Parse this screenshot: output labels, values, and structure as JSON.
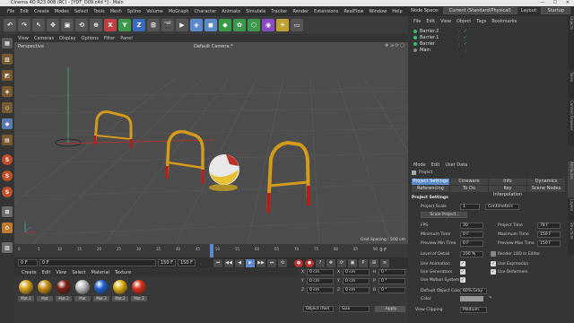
{
  "window": {
    "title": "Cinema 4D R23.008 (RC) - [YDT_D09.c4d *] - Main",
    "controls": [
      "—",
      "☐",
      "✕"
    ]
  },
  "menu": {
    "items": [
      "File",
      "Edit",
      "Create",
      "Modes",
      "Select",
      "Tools",
      "Mesh",
      "Spline",
      "Volume",
      "MoGraph",
      "Character",
      "Animate",
      "Simulate",
      "Tracker",
      "Render",
      "Extensions",
      "RealFlow",
      "Window",
      "Help"
    ],
    "node_space_label": "Node Space:",
    "node_space_value": "Current (Standard/Physical)",
    "layout_label": "Layout:",
    "layout_value": "Startup"
  },
  "toolbar": {
    "buttons": [
      "↶",
      "↷",
      "↖",
      "✥",
      "▣",
      "⟲",
      "⊕",
      "X",
      "Y",
      "Z",
      "⊞",
      "🎬",
      "▶",
      "◈",
      "◼",
      "◆",
      "✿",
      "⬡",
      "◉",
      "☀",
      "▭"
    ]
  },
  "viewport": {
    "menu": [
      "View",
      "Cameras",
      "Display",
      "Options",
      "Filter",
      "Panel"
    ],
    "label": "Perspective",
    "camera": "Default Camera.*",
    "grid_spacing": "Grid Spacing : 500 cm"
  },
  "timeline": {
    "ticks": [
      "0",
      "5",
      "10",
      "15",
      "20",
      "25",
      "30",
      "35",
      "40",
      "45",
      "50",
      "55",
      "60",
      "65",
      "70",
      "75",
      "80",
      "85",
      "90"
    ],
    "frame_end": "0 F"
  },
  "playback": {
    "start": "0 F",
    "current": "0 F",
    "end": "150 F",
    "end2": "150 F"
  },
  "materials": {
    "menu": [
      "Create",
      "Edit",
      "View",
      "Select",
      "Material",
      "Texture"
    ],
    "items": [
      {
        "label": "Mat.1",
        "color": "#d9a21a"
      },
      {
        "label": "Mat",
        "color": "#c98b14"
      },
      {
        "label": "Mat.2",
        "color": "#7a1e12"
      },
      {
        "label": "Mat",
        "color": "#bfbfbf"
      },
      {
        "label": "Mat.3",
        "color": "#1e5fcf"
      },
      {
        "label": "Mat.2",
        "color": "#e0b012"
      },
      {
        "label": "Mat.3",
        "color": "#d7301a"
      }
    ]
  },
  "coords": {
    "labels": [
      "X",
      "Y",
      "Z"
    ],
    "values": [
      "0 cm",
      "0 cm",
      "0 cm"
    ],
    "hpb": [
      "H",
      "P",
      "B"
    ],
    "hpb_values": [
      "0 °",
      "0 °",
      "0 °"
    ],
    "mode": "Object (Rel)",
    "size": "Size",
    "apply": "Apply"
  },
  "objects": {
    "tabs": [
      "File",
      "Edit",
      "View",
      "Object",
      "Tags",
      "Bookmarks"
    ],
    "items": [
      "Barrier.2",
      "Barrier.1",
      "Barrier",
      "Main"
    ]
  },
  "attributes": {
    "tabs": [
      "Mode",
      "Edit",
      "User Data"
    ],
    "heading": "Project",
    "tabs_row1": [
      "Project Settings",
      "Cineware",
      "Info",
      "Dynamics"
    ],
    "tabs_row2": [
      "Referencing",
      "To Do",
      "Key Interpolation",
      "Scene Nodes"
    ],
    "section": "Project Settings",
    "project_scale_label": "Project Scale",
    "project_scale_value": "1",
    "project_scale_unit": "Centimeters",
    "scale_button": "Scale Project...",
    "fps_label": "FPS",
    "fps_value": "30",
    "project_time_label": "Project Time",
    "project_time_value": "78 F",
    "min_time_label": "Minimum Time",
    "min_time_value": "0 F",
    "max_time_label": "Maximum Time",
    "max_time_value": "150 F",
    "prev_min_label": "Preview Min Time",
    "prev_min_value": "0 F",
    "prev_max_label": "Preview Max Time",
    "prev_max_value": "150 F",
    "lod_label": "Level of Detail",
    "lod_value": "100 %",
    "render_lod_label": "Render LOD in Editor",
    "use_animation": "Use Animation",
    "use_expression": "Use Expression",
    "use_generators": "Use Generators",
    "use_deformers": "Use Deformers",
    "use_motion": "Use Motion System",
    "default_color_label": "Default Object Color",
    "default_color_value": "60% Gray",
    "color_label": "Color",
    "view_clipping_label": "View Clipping",
    "view_clipping_value": "Medium"
  },
  "side_tabs": [
    "Attributes",
    "Layers",
    "Structure"
  ],
  "side_tabs_top": [
    "Objects",
    "Takes",
    "Content Browser"
  ]
}
